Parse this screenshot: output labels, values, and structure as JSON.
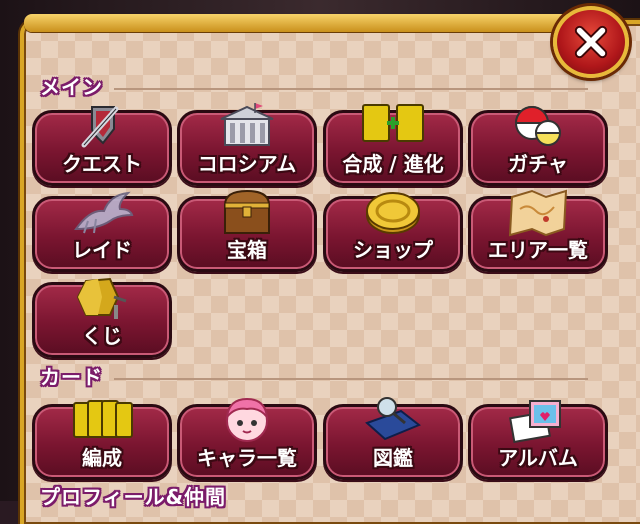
{
  "sections": {
    "main": {
      "title": "メイン"
    },
    "card": {
      "title": "カード"
    },
    "profile": {
      "title": "プロフィール&仲間"
    }
  },
  "main_tiles": [
    {
      "label": "クエスト",
      "icon": "sword-shield-icon"
    },
    {
      "label": "コロシアム",
      "icon": "colosseum-icon"
    },
    {
      "label": "合成 / 進化",
      "icon": "card-fusion-icon"
    },
    {
      "label": "ガチャ",
      "icon": "gacha-capsule-icon"
    },
    {
      "label": "レイド",
      "icon": "dragon-icon"
    },
    {
      "label": "宝箱",
      "icon": "treasure-chest-icon"
    },
    {
      "label": "ショップ",
      "icon": "coin-icon"
    },
    {
      "label": "エリア一覧",
      "icon": "map-icon"
    },
    {
      "label": "くじ",
      "icon": "lottery-wheel-icon"
    }
  ],
  "card_tiles": [
    {
      "label": "編成",
      "icon": "card-deck-icon"
    },
    {
      "label": "キャラ一覧",
      "icon": "character-face-icon"
    },
    {
      "label": "図鑑",
      "icon": "encyclopedia-icon"
    },
    {
      "label": "アルバム",
      "icon": "photo-album-icon"
    }
  ],
  "close": {
    "icon": "close-icon"
  },
  "colors": {
    "tile": "#7a1530",
    "frame": "#d9a626",
    "close": "#b0171a",
    "heading": "#7b1c6a"
  }
}
